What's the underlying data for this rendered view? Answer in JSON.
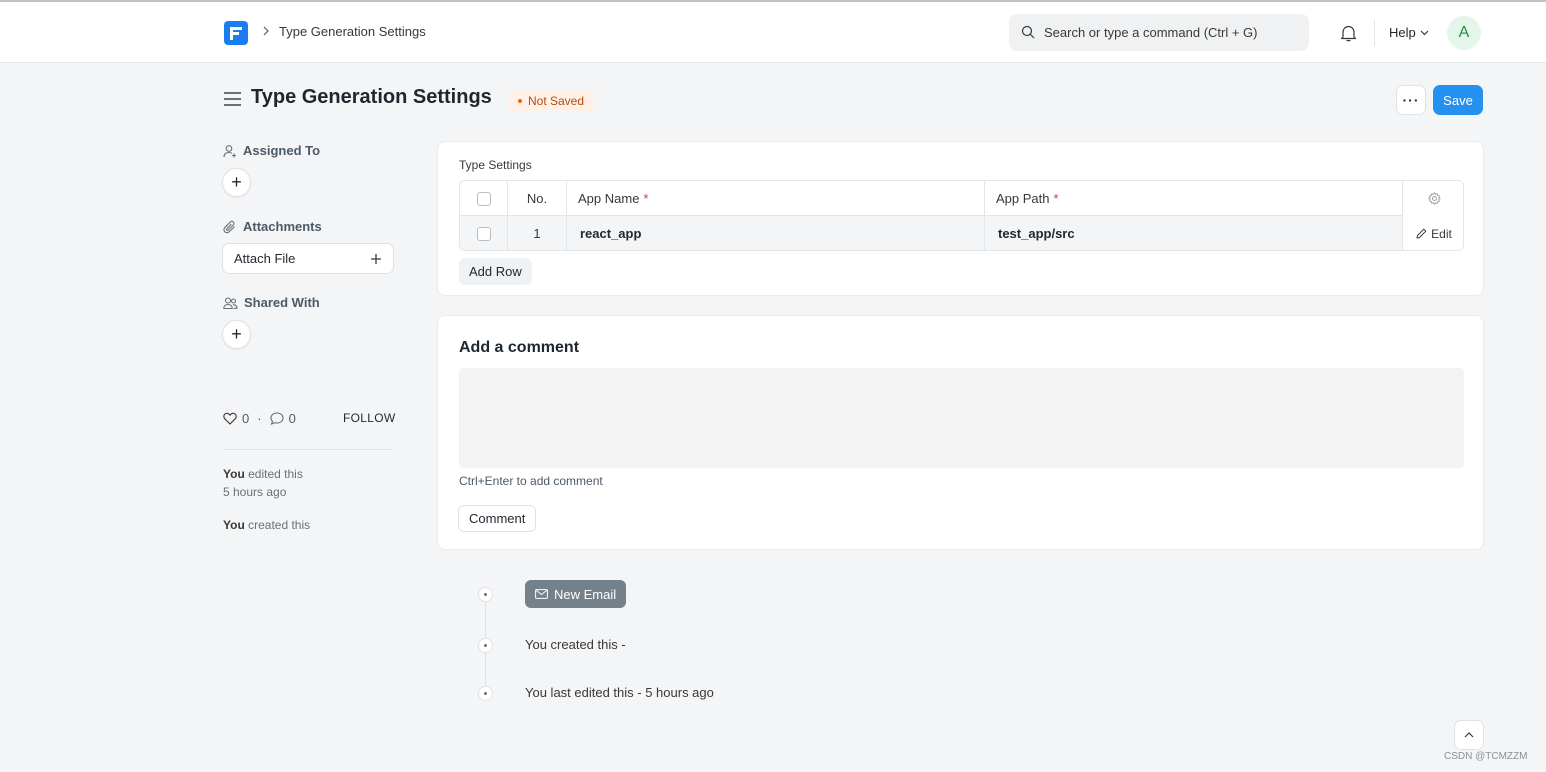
{
  "navbar": {
    "breadcrumb": "Type Generation Settings",
    "search_placeholder": "Search or type a command (Ctrl + G)",
    "help_label": "Help",
    "avatar_initial": "A"
  },
  "page": {
    "title": "Type Generation Settings",
    "status": "Not Saved",
    "more_label": "···",
    "save_label": "Save"
  },
  "sidebar": {
    "assigned_to": "Assigned To",
    "attachments": "Attachments",
    "attach_file": "Attach File",
    "shared_with": "Shared With",
    "likes": "0",
    "comments": "0",
    "follow": "FOLLOW",
    "activity": [
      {
        "who": "You",
        "text": " edited this",
        "when": "5 hours ago"
      },
      {
        "who": "You",
        "text": " created this",
        "when": ""
      }
    ]
  },
  "type_settings": {
    "label": "Type Settings",
    "columns": {
      "no": "No.",
      "app_name": "App Name",
      "app_path": "App Path",
      "required_mark": "*"
    },
    "rows": [
      {
        "no": "1",
        "app_name": "react_app",
        "app_path": "test_app/src",
        "edit": "Edit"
      }
    ],
    "add_row": "Add Row"
  },
  "comment": {
    "title": "Add a comment",
    "hint": "Ctrl+Enter to add comment",
    "button": "Comment"
  },
  "timeline": {
    "new_email": "New Email",
    "created": "You created this -",
    "edited": "You last edited this - 5 hours ago"
  },
  "watermark": "CSDN @TCMZZM",
  "colors": {
    "primary": "#2490ef",
    "logo": "#1a7cf0",
    "status_bg": "#fff1e7",
    "status_text": "#b84b0a"
  }
}
